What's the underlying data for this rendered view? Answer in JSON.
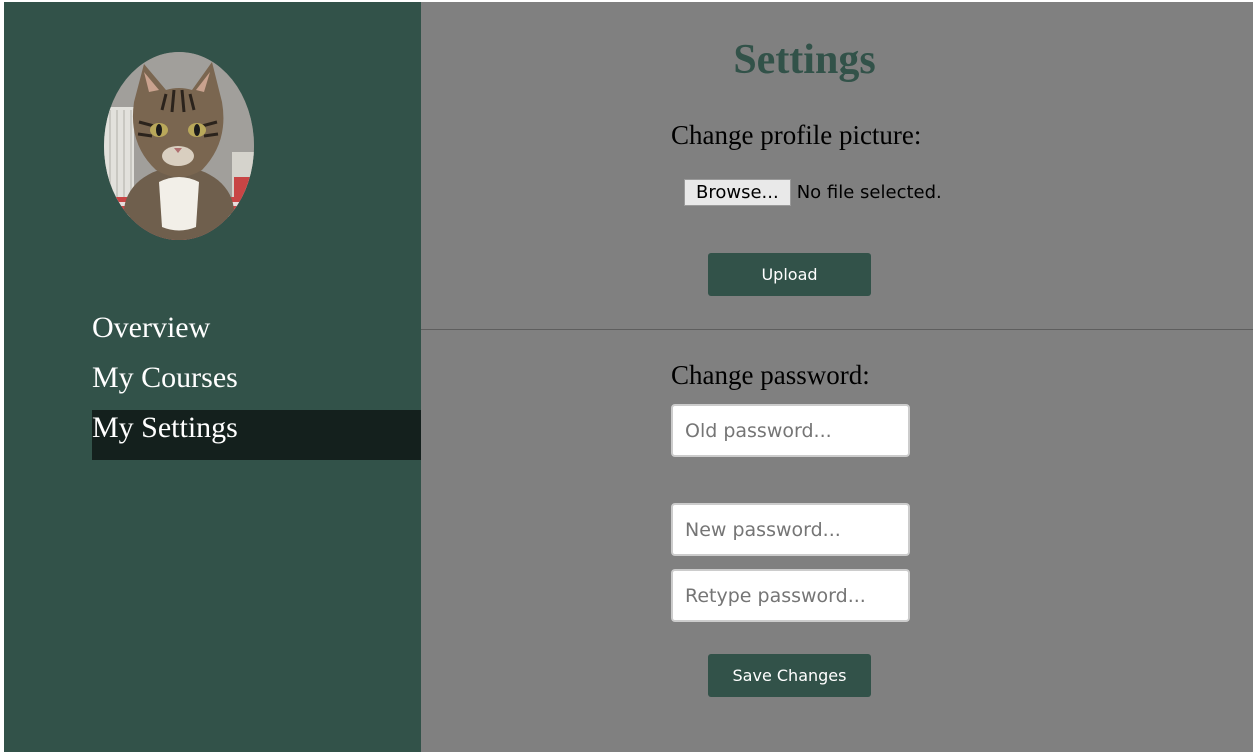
{
  "sidebar": {
    "avatar_alt": "Profile picture of a tabby cat",
    "nav": [
      {
        "label": "Overview",
        "active": false
      },
      {
        "label": "My Courses",
        "active": false
      },
      {
        "label": "My Settings",
        "active": true
      }
    ]
  },
  "main": {
    "title": "Settings",
    "profile_picture": {
      "heading": "Change profile picture:",
      "browse_label": "Browse...",
      "file_status": "No file selected.",
      "upload_label": "Upload"
    },
    "password": {
      "heading": "Change password:",
      "old_placeholder": "Old password...",
      "new_placeholder": "New password...",
      "retype_placeholder": "Retype password...",
      "save_label": "Save Changes"
    }
  },
  "colors": {
    "sidebar_bg": "#325249",
    "nav_active_bg": "#14201d",
    "main_bg": "#808080",
    "accent": "#325249"
  },
  "icons": {
    "avatar": "tabby-cat-photo"
  }
}
